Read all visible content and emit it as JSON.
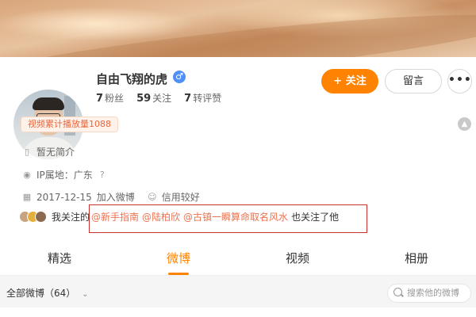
{
  "profile": {
    "username": "自由飞翔的虎",
    "verify_icon": "verified-badge-icon",
    "stats": [
      {
        "num": "7",
        "label": "粉丝"
      },
      {
        "num": "59",
        "label": "关注"
      },
      {
        "num": "7",
        "label": "转评赞"
      }
    ]
  },
  "actions": {
    "follow_label": "+ 关注",
    "message_label": "留言",
    "more_label": "•••"
  },
  "badge": {
    "play_count": "视频累计播放量1088"
  },
  "info": {
    "bio": "暂无简介",
    "ip": "IP属地：广东",
    "join_date": "2017-12-15",
    "join_suffix": "加入微博",
    "credit": "信用较好"
  },
  "mutual": {
    "prefix": "我关注的",
    "mentions": [
      "@新手指南",
      "@陆柏欣",
      "@古镇一瞬算命取名风水"
    ],
    "suffix": "也关注了他"
  },
  "tabs": [
    {
      "label": "精选"
    },
    {
      "label": "微博"
    },
    {
      "label": "视频"
    },
    {
      "label": "相册"
    }
  ],
  "filter": {
    "label": "全部微博（64）",
    "search_placeholder": "搜索他的微博"
  },
  "colors": {
    "accent": "#ff8200",
    "mention": "#eb7350",
    "highlight_box": "#c7302c"
  }
}
